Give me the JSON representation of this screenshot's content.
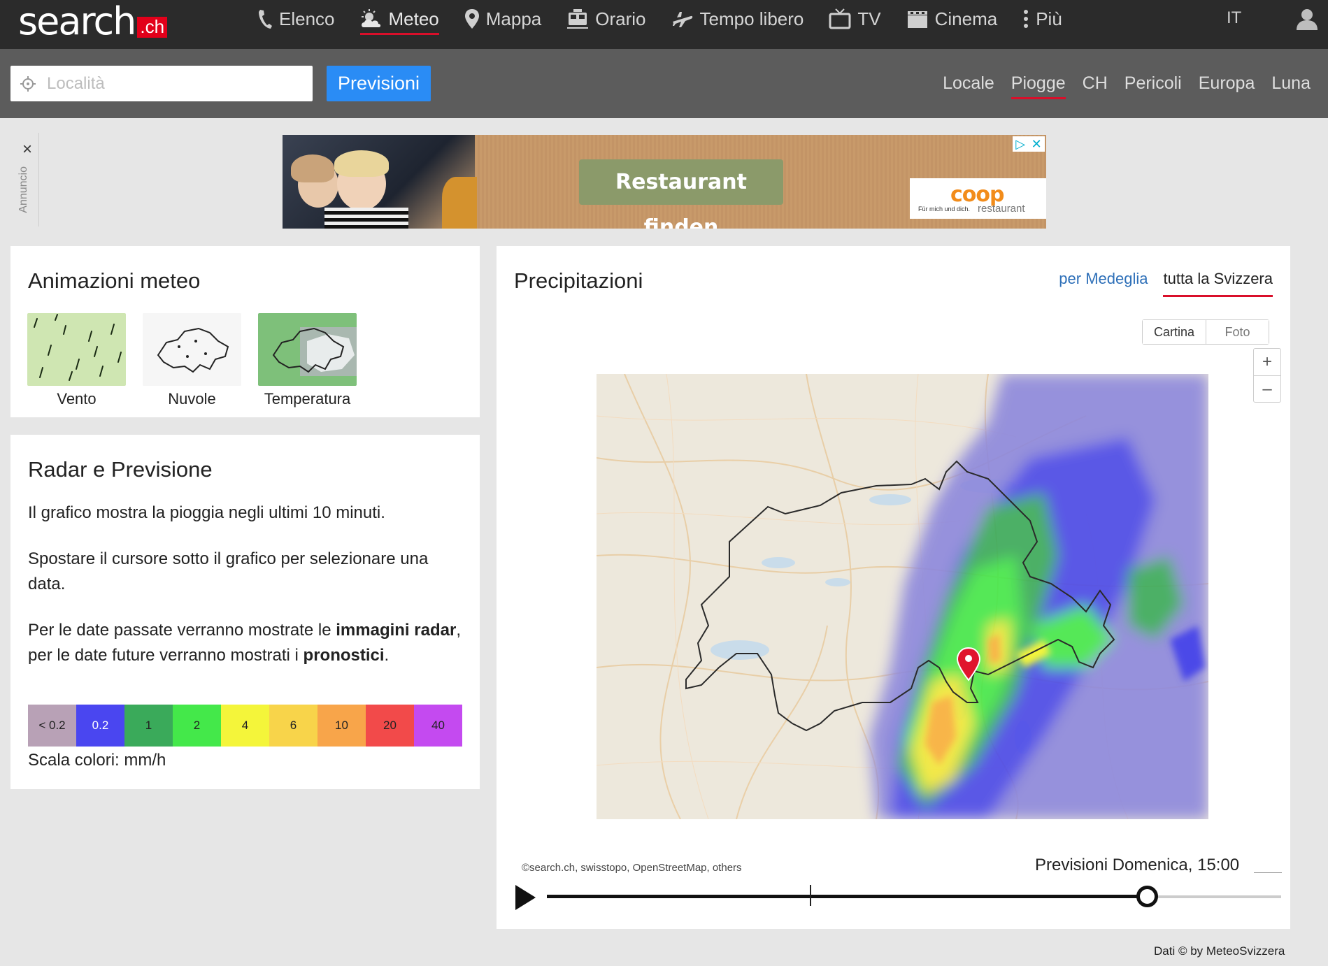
{
  "brand": {
    "name": "search",
    "suffix": ".ch"
  },
  "nav": {
    "items": [
      {
        "label": "Elenco",
        "icon": "phone-icon"
      },
      {
        "label": "Meteo",
        "icon": "weather-icon"
      },
      {
        "label": "Mappa",
        "icon": "map-pin-icon"
      },
      {
        "label": "Orario",
        "icon": "train-icon"
      },
      {
        "label": "Tempo libero",
        "icon": "plane-icon"
      },
      {
        "label": "TV",
        "icon": "tv-icon"
      },
      {
        "label": "Cinema",
        "icon": "film-icon"
      },
      {
        "label": "Più",
        "icon": "more-vertical-icon"
      }
    ],
    "active": "Meteo",
    "language": "IT",
    "user_icon": "user-icon"
  },
  "search": {
    "placeholder": "Località",
    "value": "",
    "button_label": "Previsioni",
    "icon": "locate-icon"
  },
  "subnav": {
    "items": [
      "Locale",
      "Piogge",
      "CH",
      "Pericoli",
      "Europa",
      "Luna"
    ],
    "active": "Piogge"
  },
  "ad": {
    "label": "Annuncio",
    "close": "×",
    "cta": "Restaurant finden",
    "brand": "coop",
    "tagline": "Für mich und dich.",
    "brand_sub": "restaurant"
  },
  "animations": {
    "title": "Animazioni meteo",
    "items": [
      {
        "label": "Vento"
      },
      {
        "label": "Nuvole"
      },
      {
        "label": "Temperatura"
      }
    ]
  },
  "radar": {
    "title": "Radar e Previsione",
    "p1": "Il grafico mostra la pioggia negli ultimi 10 minuti.",
    "p2": "Spostare il cursore sotto il grafico per selezionare una data.",
    "p3_a": "Per le date passate verranno mostrate le ",
    "p3_b": "immagini radar",
    "p3_c": ", per le date future verranno mostrati i ",
    "p3_d": "pronostici",
    "p3_e": ".",
    "legend": [
      {
        "label": "< 0.2",
        "color": "#b8a1b6"
      },
      {
        "label": "0.2",
        "color": "#4a46f0"
      },
      {
        "label": "1",
        "color": "#3aaa5a"
      },
      {
        "label": "2",
        "color": "#44e84a"
      },
      {
        "label": "4",
        "color": "#f4f53a"
      },
      {
        "label": "6",
        "color": "#f8d44a"
      },
      {
        "label": "10",
        "color": "#f8a54a"
      },
      {
        "label": "20",
        "color": "#f24a4a"
      },
      {
        "label": "40",
        "color": "#c44af0"
      }
    ],
    "legend_caption": "Scala colori: mm/h"
  },
  "precip": {
    "title": "Precipitazioni",
    "tabs": [
      {
        "label": "per Medeglia"
      },
      {
        "label": "tutta la Svizzera"
      }
    ],
    "active_tab": "tutta la Svizzera",
    "modes": [
      "Cartina",
      "Foto"
    ],
    "active_mode": "Cartina",
    "zoom_in": "+",
    "zoom_out": "–",
    "attribution": "©search.ch, swisstopo, OpenStreetMap, others",
    "forecast_label": "Previsioni Domenica, 15:00",
    "timeline_position": 0.817,
    "now_marker": 0.358,
    "data_credit": "Dati © by MeteoSvizzera"
  },
  "colors": {
    "accent_red": "#d90f2a",
    "primary_blue": "#2a8cf5",
    "nav_bg": "#2b2b2b",
    "subbar_bg": "#5c5c5c",
    "link_blue": "#2d6fb8"
  }
}
